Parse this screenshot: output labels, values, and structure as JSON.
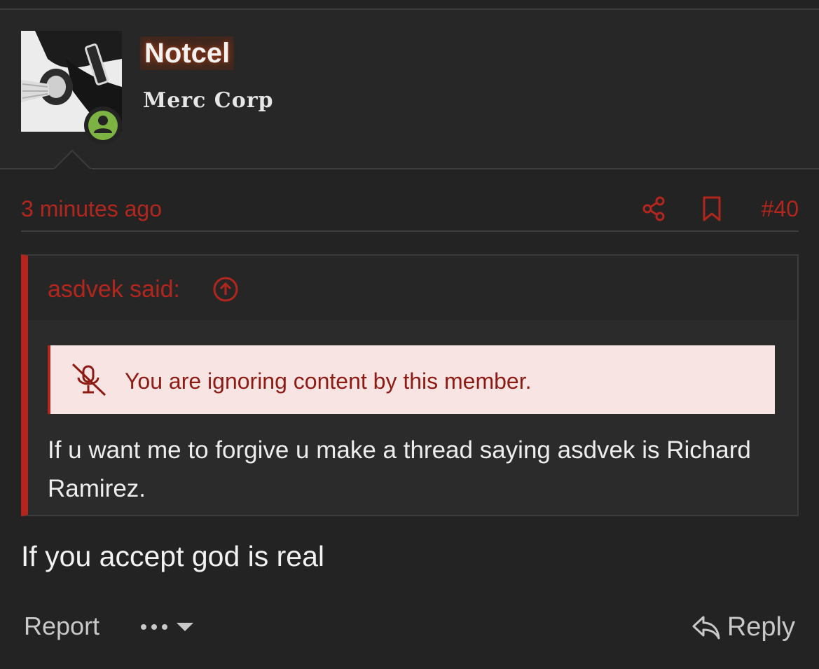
{
  "user": {
    "name": "Notcel",
    "title": "Merc Corp",
    "status": "online"
  },
  "post": {
    "time": "3 minutes ago",
    "number": "#40",
    "body": "If you accept god is real"
  },
  "quote": {
    "author_label": "asdvek said:",
    "ignored_notice": "You are ignoring content by this member.",
    "body": "If u want me to forgive u make a thread saying asdvek is Richard Ramirez."
  },
  "footer": {
    "report_label": "Report",
    "reply_label": "Reply"
  },
  "colors": {
    "accent": "#b3261e",
    "background": "#232323",
    "online": "#7cb342",
    "notice_bg": "#f8e4e2"
  },
  "icons": [
    "share-icon",
    "bookmark-icon",
    "arrow-circle-up-icon",
    "microphone-slash-icon",
    "ellipsis-icon",
    "chevron-down-icon",
    "reply-icon",
    "user-icon"
  ]
}
